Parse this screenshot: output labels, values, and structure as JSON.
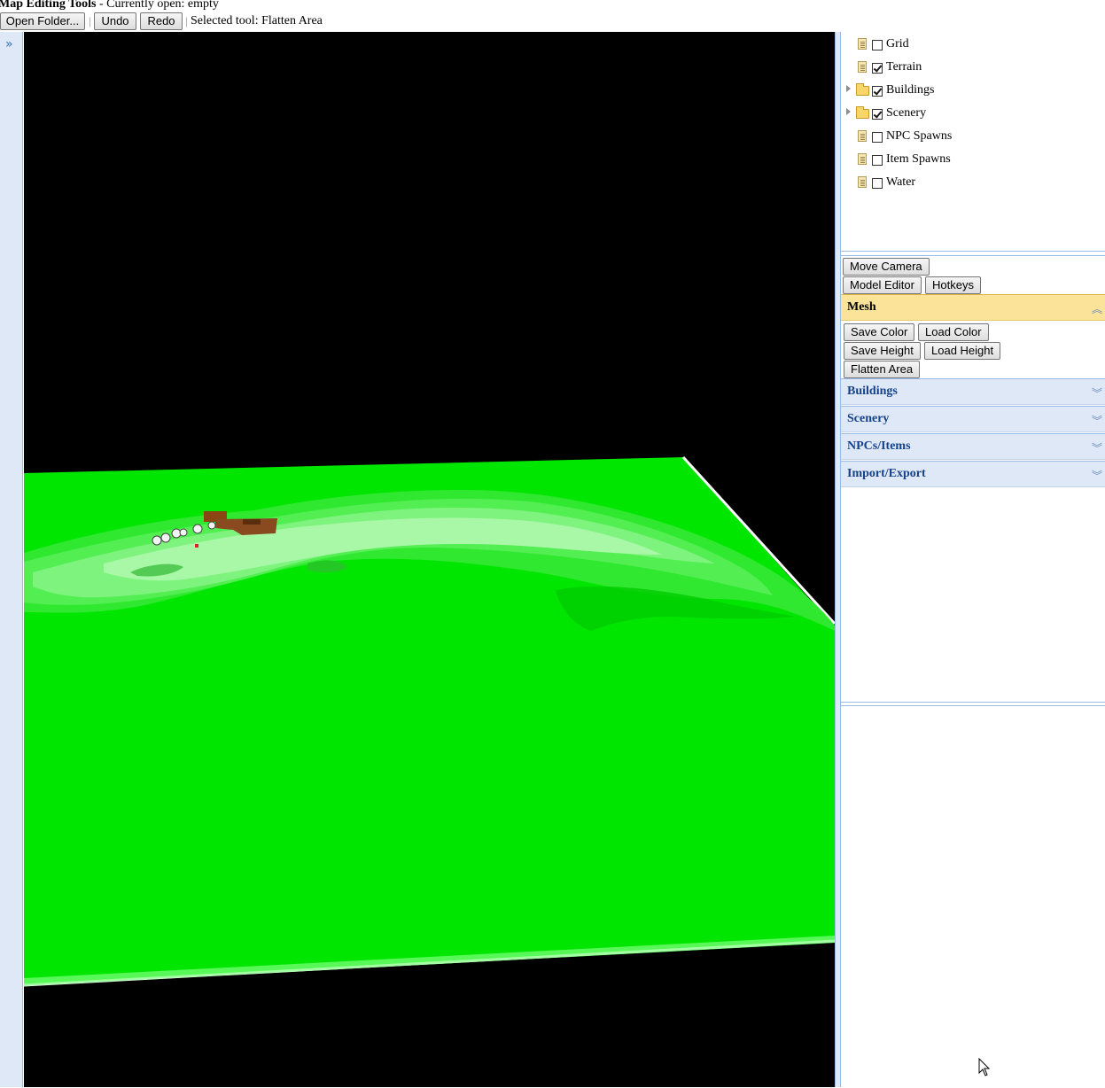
{
  "header": {
    "app_title": "Map Editing Tools",
    "separator": " - ",
    "open_status": "Currently open: empty"
  },
  "toolbar": {
    "open_folder_label": "Open Folder...",
    "undo_label": "Undo",
    "redo_label": "Redo",
    "separator": "|",
    "selected_tool": "Selected tool: Flatten Area"
  },
  "sidebar": {
    "expand_icon": "double-chevron-right-icon"
  },
  "layers": [
    {
      "label": "Grid",
      "checked": false,
      "type": "file",
      "expandable": false
    },
    {
      "label": "Terrain",
      "checked": true,
      "type": "file",
      "expandable": false
    },
    {
      "label": "Buildings",
      "checked": true,
      "type": "folder",
      "expandable": true
    },
    {
      "label": "Scenery",
      "checked": true,
      "type": "folder",
      "expandable": true
    },
    {
      "label": "NPC Spawns",
      "checked": false,
      "type": "file",
      "expandable": false
    },
    {
      "label": "Item Spawns",
      "checked": false,
      "type": "file",
      "expandable": false
    },
    {
      "label": "Water",
      "checked": false,
      "type": "file",
      "expandable": false
    }
  ],
  "tools": {
    "move_camera": "Move Camera",
    "model_editor": "Model Editor",
    "hotkeys": "Hotkeys"
  },
  "sections": {
    "mesh": {
      "title": "Mesh",
      "expanded": true,
      "buttons": {
        "save_color": "Save Color",
        "load_color": "Load Color",
        "save_height": "Save Height",
        "load_height": "Load Height",
        "flatten_area": "Flatten Area"
      }
    },
    "buildings": {
      "title": "Buildings",
      "expanded": false
    },
    "scenery": {
      "title": "Scenery",
      "expanded": false
    },
    "npcs_items": {
      "title": "NPCs/Items",
      "expanded": false
    },
    "import_export": {
      "title": "Import/Export",
      "expanded": false
    }
  },
  "colors": {
    "terrain_base": "#00e600",
    "background": "#000000",
    "panel_blue": "#dfe8f6",
    "active_header": "#fbe39a"
  }
}
